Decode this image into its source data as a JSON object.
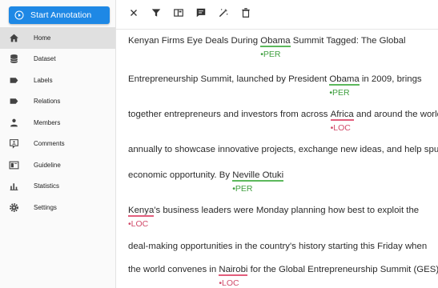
{
  "sidebar": {
    "start_button": "Start Annotation",
    "items": [
      {
        "label": "Home",
        "icon": "home-icon",
        "active": true
      },
      {
        "label": "Dataset",
        "icon": "database-icon",
        "active": false
      },
      {
        "label": "Labels",
        "icon": "label-icon",
        "active": false
      },
      {
        "label": "Relations",
        "icon": "label-icon",
        "active": false
      },
      {
        "label": "Members",
        "icon": "person-icon",
        "active": false
      },
      {
        "label": "Comments",
        "icon": "comment-account-icon",
        "active": false
      },
      {
        "label": "Guideline",
        "icon": "book-open-icon",
        "active": false
      },
      {
        "label": "Statistics",
        "icon": "chart-bar-icon",
        "active": false
      },
      {
        "label": "Settings",
        "icon": "gear-icon",
        "active": false
      }
    ]
  },
  "toolbar": {
    "buttons": [
      "close-icon",
      "filter-icon",
      "view-column-icon",
      "comment-icon",
      "magic-wand-icon",
      "delete-icon"
    ]
  },
  "colors": {
    "accent": "#1e88e5",
    "per": "#5cb85c",
    "loc": "#e35d7c"
  },
  "document": {
    "lines": [
      {
        "segments": [
          {
            "text": "Kenyan Firms Eye Deals During "
          },
          {
            "text": "Obama",
            "label": "PER"
          },
          {
            "text": " Summit Tagged: The Global"
          }
        ]
      },
      {
        "segments": [
          {
            "text": "Entrepreneurship Summit, launched by President "
          },
          {
            "text": "Obama",
            "label": "PER"
          },
          {
            "text": " in 2009, brings"
          }
        ]
      },
      {
        "segments": [
          {
            "text": "together entrepreneurs and investors from across "
          },
          {
            "text": "Africa",
            "label": "LOC"
          },
          {
            "text": " and around the world"
          }
        ]
      },
      {
        "segments": [
          {
            "text": " annually to showcase innovative projects, exchange new ideas, and help spur"
          }
        ]
      },
      {
        "segments": [
          {
            "text": " economic opportunity. By "
          },
          {
            "text": "Neville Otuki",
            "label": "PER"
          }
        ]
      },
      {
        "segments": [
          {
            "text": "Kenya",
            "label": "LOC"
          },
          {
            "text": "'s business leaders were Monday planning how best to exploit the"
          }
        ]
      },
      {
        "segments": [
          {
            "text": "deal-making opportunities in the country's history starting this Friday when"
          }
        ]
      },
      {
        "segments": [
          {
            "text": "the world convenes in "
          },
          {
            "text": "Nairobi",
            "label": "LOC"
          },
          {
            "text": " for the Global Entrepreneurship Summit (GES)."
          }
        ]
      }
    ]
  }
}
